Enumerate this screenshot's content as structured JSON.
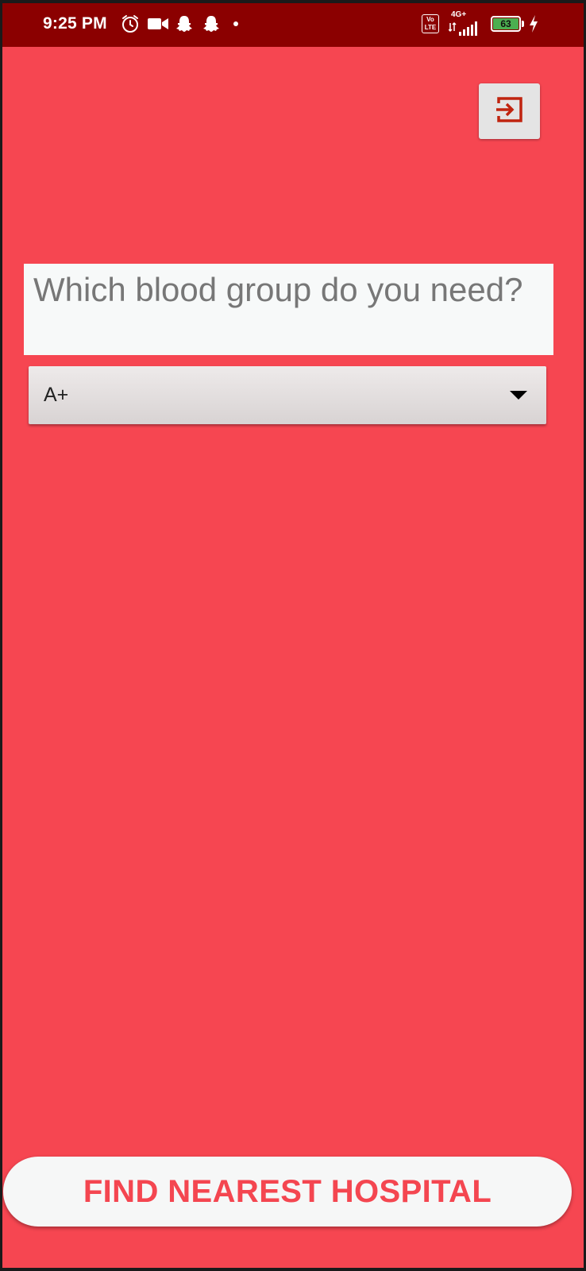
{
  "status_bar": {
    "time": "9:25 PM",
    "volte_label": "Vo\nLTE",
    "network_label": "4G+",
    "battery_level": "63",
    "icons": [
      "alarm-icon",
      "video-camera-icon",
      "snapchat-icon",
      "snapchat-icon",
      "notification-dot-icon",
      "volte-icon",
      "signal-icon",
      "battery-icon",
      "charging-icon"
    ]
  },
  "header": {
    "logout_icon": "logout-icon"
  },
  "main": {
    "question": "Which blood group do you need?",
    "blood_group_selected": "A+"
  },
  "footer": {
    "find_button_label": "FIND NEAREST HOSPITAL"
  },
  "colors": {
    "background": "#f64651",
    "status_bar": "#8b0000",
    "button_text": "#f44650",
    "battery_fill": "#4caf50"
  }
}
